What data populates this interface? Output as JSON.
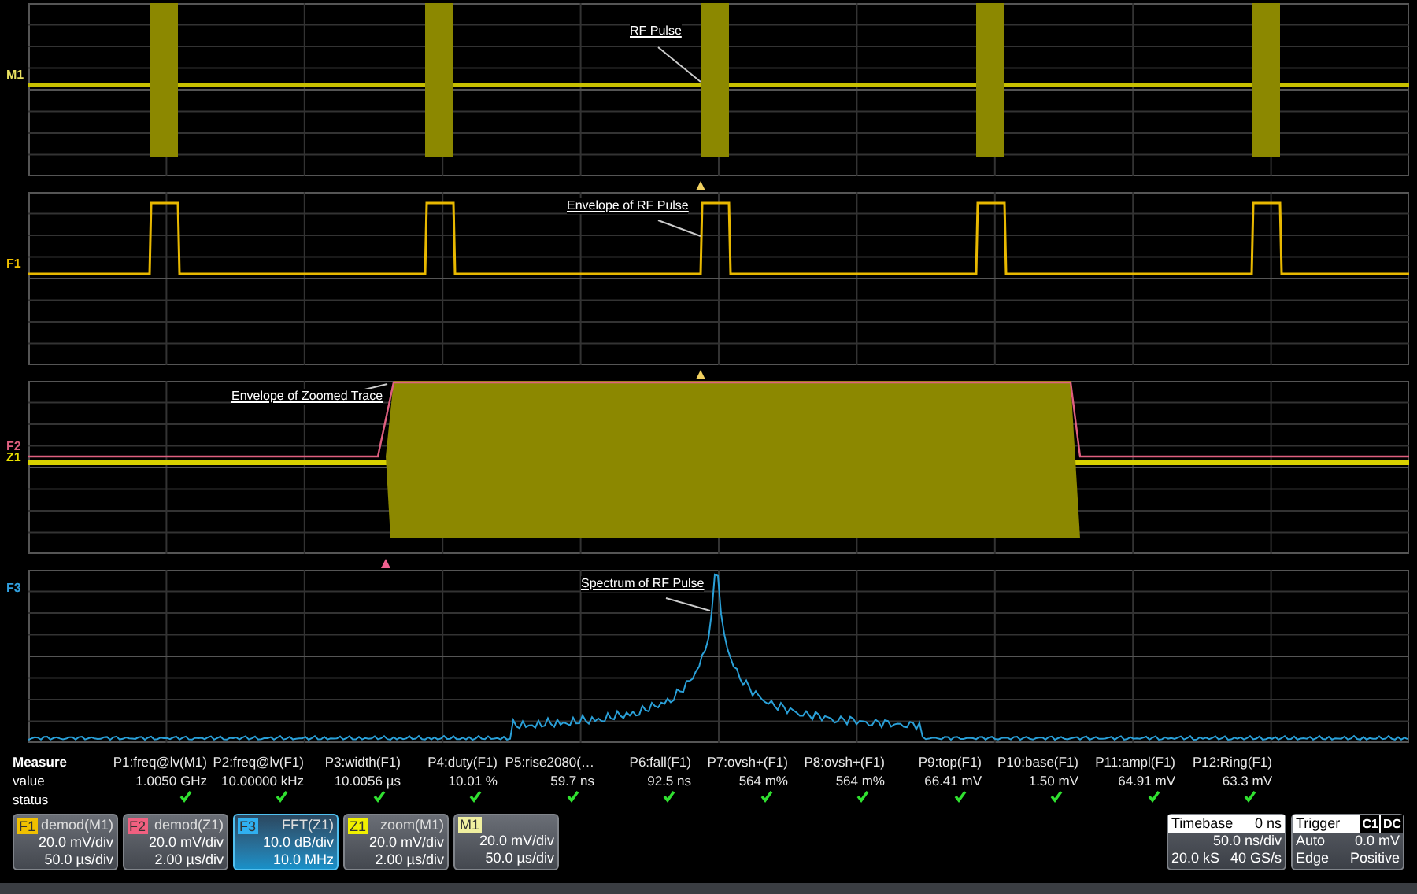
{
  "panels": [
    {
      "kind": "rf",
      "channels": [
        {
          "label": "M1",
          "color": "#e8e060"
        }
      ],
      "annotation": "RF Pulse",
      "marker": {
        "color": "#f0d060"
      }
    },
    {
      "kind": "envelope",
      "channels": [
        {
          "label": "F1",
          "color": "#f0c000"
        }
      ],
      "annotation": "Envelope of RF Pulse",
      "marker": {
        "color": "#f0d060"
      }
    },
    {
      "kind": "zoom",
      "channels": [
        {
          "label": "F2",
          "color": "#e06080"
        },
        {
          "label": "Z1",
          "color": "#e8e000"
        }
      ],
      "annotation": "Envelope of Zoomed Trace",
      "marker": {
        "color": "#f06090"
      }
    },
    {
      "kind": "spectrum",
      "channels": [
        {
          "label": "F3",
          "color": "#30a0e0"
        }
      ],
      "annotation": "Spectrum of RF Pulse"
    }
  ],
  "measure": {
    "row_labels": [
      "Measure",
      "value",
      "status"
    ],
    "params": [
      {
        "name": "P1:freq@lv(M1)",
        "value": "1.0050 GHz",
        "passed": true
      },
      {
        "name": "P2:freq@lv(F1)",
        "value": "10.00000 kHz",
        "passed": true
      },
      {
        "name": "P3:width(F1)",
        "value": "10.0056 µs",
        "passed": true
      },
      {
        "name": "P4:duty(F1)",
        "value": "10.01 %",
        "passed": true
      },
      {
        "name": "P5:rise2080(…",
        "value": "59.7 ns",
        "passed": true
      },
      {
        "name": "P6:fall(F1)",
        "value": "92.5 ns",
        "passed": true
      },
      {
        "name": "P7:ovsh+(F1)",
        "value": "564 m%",
        "passed": true
      },
      {
        "name": "P8:ovsh+(F1)",
        "value": "564 m%",
        "passed": true
      },
      {
        "name": "P9:top(F1)",
        "value": "66.41 mV",
        "passed": true
      },
      {
        "name": "P10:base(F1)",
        "value": "1.50 mV",
        "passed": true
      },
      {
        "name": "P11:ampl(F1)",
        "value": "64.91 mV",
        "passed": true
      },
      {
        "name": "P12:Ring(F1)",
        "value": "63.3 mV",
        "passed": true
      }
    ]
  },
  "descriptors": [
    {
      "tag": "F1",
      "color": "#f0c000",
      "title": "demod(M1)",
      "scale": "20.0 mV/div",
      "time": "50.0 µs/div",
      "selected": false
    },
    {
      "tag": "F2",
      "color": "#f06080",
      "title": "demod(Z1)",
      "scale": "20.0 mV/div",
      "time": "2.00 µs/div",
      "selected": false
    },
    {
      "tag": "F3",
      "color": "#30b0f0",
      "title": "FFT(Z1)",
      "scale": "10.0 dB/div",
      "time": "10.0 MHz",
      "selected": true
    },
    {
      "tag": "Z1",
      "color": "#f0f000",
      "title": "zoom(M1)",
      "scale": "20.0 mV/div",
      "time": "2.00 µs/div",
      "selected": false
    },
    {
      "tag": "M1",
      "color": "#f0f0a0",
      "scale": "20.0 mV/div",
      "time": "50.0 µs/div",
      "selected": false
    }
  ],
  "timebase": {
    "label": "Timebase",
    "delay": "0 ns",
    "rate": "50.0 ns/div",
    "samples": "20.0 kS",
    "sample_rate": "40 GS/s"
  },
  "trigger": {
    "label": "Trigger",
    "tags": [
      "C1",
      "DC"
    ],
    "mode": "Auto",
    "level": "0.0 mV",
    "type": "Edge",
    "slope": "Positive"
  }
}
